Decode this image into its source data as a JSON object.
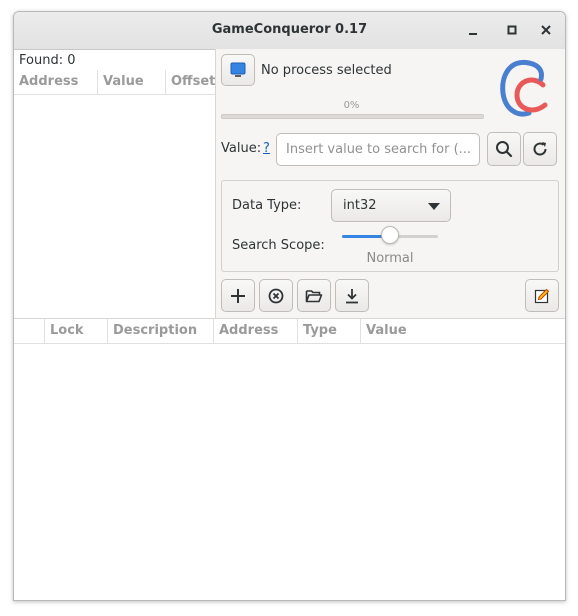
{
  "window": {
    "title": "GameConqueror 0.17"
  },
  "found": {
    "label": "Found:",
    "count": "0"
  },
  "results_table": {
    "columns": [
      "Address",
      "Value",
      "Offset"
    ]
  },
  "process": {
    "label": "No process selected"
  },
  "progress": {
    "text": "0%",
    "value": 0
  },
  "search": {
    "label": "Value:",
    "help": "?",
    "placeholder": "Insert value to search for (...",
    "value": ""
  },
  "settings": {
    "data_type_label": "Data Type:",
    "data_type_value": "int32",
    "scope_label": "Search Scope:",
    "scope_value": "Normal",
    "scope_level": 0.5
  },
  "cheat_table": {
    "columns": [
      "",
      "Lock",
      "Description",
      "Address",
      "Type",
      "Value"
    ]
  },
  "colors": {
    "accent": "#3584e4",
    "logo_blue": "#4a7fd0",
    "logo_red": "#e85a5a"
  },
  "icons": {
    "process": "monitor-icon",
    "search": "search-icon",
    "reset": "refresh-icon",
    "add": "add-icon",
    "clear": "clear-icon",
    "open": "folder-open-icon",
    "save": "download-icon",
    "edit": "edit-icon"
  }
}
